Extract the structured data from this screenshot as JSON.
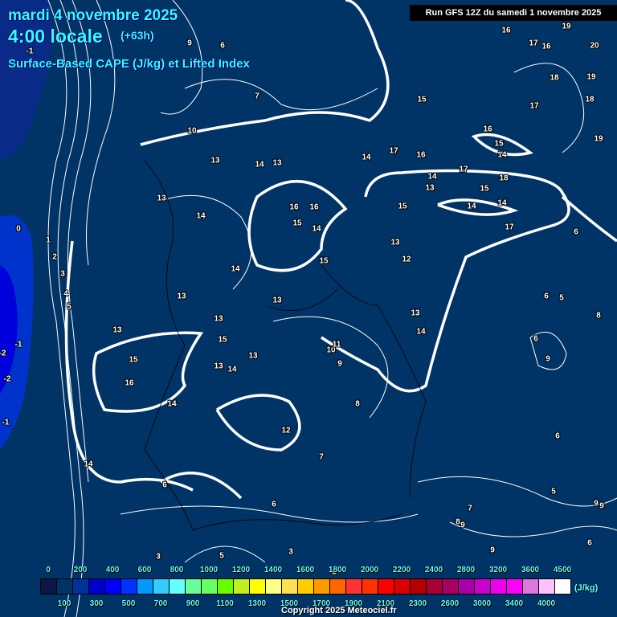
{
  "header": {
    "date": "mardi 4 novembre 2025",
    "time": "4:00 locale",
    "lead": "(+63h)",
    "parameter": "Surface-Based CAPE (J/kg) et Lifted Index",
    "run": "Run GFS 12Z du samedi 1 novembre 2025"
  },
  "legend": {
    "unit": "(J/kg)",
    "values": [
      "0",
      "100",
      "200",
      "300",
      "400",
      "500",
      "600",
      "700",
      "800",
      "900",
      "1000",
      "1100",
      "1200",
      "1300",
      "1400",
      "1500",
      "1600",
      "1700",
      "1800",
      "1900",
      "2000",
      "2100",
      "2200",
      "2300",
      "2400",
      "2600",
      "2800",
      "3000",
      "3200",
      "3400",
      "3600",
      "4000",
      "4500"
    ],
    "colors": [
      "#0a1848",
      "#003366",
      "#003399",
      "#0000cc",
      "#0000ff",
      "#0033ff",
      "#0099ff",
      "#33ccff",
      "#66ffff",
      "#66ff99",
      "#66ff66",
      "#66ff00",
      "#c0f020",
      "#ffff00",
      "#ffff88",
      "#ffe050",
      "#ffcc00",
      "#ff9900",
      "#ff6600",
      "#ff3333",
      "#ff3300",
      "#ff0000",
      "#dd0000",
      "#b30000",
      "#aa0033",
      "#aa0066",
      "#aa00aa",
      "#cc00cc",
      "#ee00ee",
      "#ff00ff",
      "#dd77dd",
      "#ffc0ff",
      "#ffffff"
    ]
  },
  "lifted_index_labels": [
    "9",
    "6",
    "-1",
    "7",
    "10",
    "13",
    "14",
    "13",
    "13",
    "14",
    "16",
    "16",
    "15",
    "14",
    "15",
    "14",
    "13",
    "13",
    "13",
    "13",
    "15",
    "13",
    "13",
    "14",
    "15",
    "16",
    "14",
    "10",
    "11",
    "9",
    "8",
    "12",
    "7",
    "14",
    "6",
    "6",
    "3",
    "5",
    "3",
    "2",
    "0",
    "1",
    "2",
    "3",
    "4",
    "5",
    "-1",
    "-2",
    "-2",
    "-1",
    "16",
    "19",
    "17",
    "16",
    "20",
    "18",
    "19",
    "18",
    "15",
    "17",
    "16",
    "15",
    "14",
    "19",
    "17",
    "16",
    "14",
    "17",
    "18",
    "14",
    "13",
    "15",
    "14",
    "14",
    "15",
    "17",
    "6",
    "13",
    "12",
    "6",
    "5",
    "8",
    "13",
    "14",
    "6",
    "9",
    "6",
    "5",
    "7",
    "8",
    "9",
    "9",
    "9",
    "9",
    "6"
  ],
  "copyright": "Copyright 2025 Meteociel.fr"
}
